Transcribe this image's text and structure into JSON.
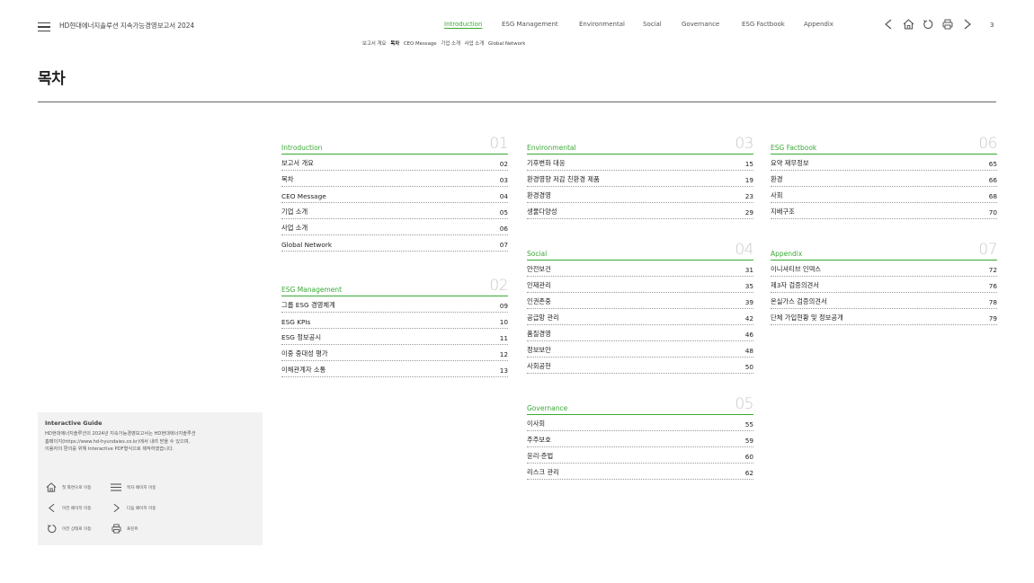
{
  "header": {
    "doc_title": "HD현대에너지솔루션 지속가능경영보고서 2024",
    "nav": [
      {
        "label": "Introduction",
        "active": true
      },
      {
        "label": "ESG Management",
        "active": false
      },
      {
        "label": "Environmental",
        "active": false
      },
      {
        "label": "Social",
        "active": false
      },
      {
        "label": "Governance",
        "active": false
      },
      {
        "label": "ESG Factbook",
        "active": false
      },
      {
        "label": "Appendix",
        "active": false
      }
    ],
    "icons": [
      "prev-icon",
      "home-icon",
      "back-icon",
      "print-icon",
      "next-icon"
    ],
    "page_number": "3",
    "subnav": [
      {
        "label": "보고서 개요",
        "active": false
      },
      {
        "label": "목차",
        "active": true
      },
      {
        "label": "CEO Message",
        "active": false
      },
      {
        "label": "기업 소개",
        "active": false
      },
      {
        "label": "사업 소개",
        "active": false
      },
      {
        "label": "Global Network",
        "active": false
      }
    ]
  },
  "page_title": "목차",
  "sections": {
    "introduction": {
      "title": "Introduction",
      "num": "01",
      "items": [
        {
          "label": "보고서 개요",
          "page": "02"
        },
        {
          "label": "목차",
          "page": "03"
        },
        {
          "label": "CEO Message",
          "page": "04"
        },
        {
          "label": "기업 소개",
          "page": "05"
        },
        {
          "label": "사업 소개",
          "page": "06"
        },
        {
          "label": "Global Network",
          "page": "07"
        }
      ]
    },
    "esg_management": {
      "title": "ESG Management",
      "num": "02",
      "items": [
        {
          "label": "그룹 ESG 경영체계",
          "page": "09"
        },
        {
          "label": "ESG KPIs",
          "page": "10"
        },
        {
          "label": "ESG 정보공시",
          "page": "11"
        },
        {
          "label": "이중 중대성 평가",
          "page": "12"
        },
        {
          "label": "이해관계자 소통",
          "page": "13"
        }
      ]
    },
    "environmental": {
      "title": "Environmental",
      "num": "03",
      "items": [
        {
          "label": "기후변화 대응",
          "page": "15"
        },
        {
          "label": "환경영향 저감 친환경 제품",
          "page": "19"
        },
        {
          "label": "환경경영",
          "page": "23"
        },
        {
          "label": "생물다양성",
          "page": "29"
        }
      ]
    },
    "social": {
      "title": "Social",
      "num": "04",
      "items": [
        {
          "label": "안전보건",
          "page": "31"
        },
        {
          "label": "인재관리",
          "page": "35"
        },
        {
          "label": "인권존중",
          "page": "39"
        },
        {
          "label": "공급망 관리",
          "page": "42"
        },
        {
          "label": "품질경영",
          "page": "46"
        },
        {
          "label": "정보보안",
          "page": "48"
        },
        {
          "label": "사회공헌",
          "page": "50"
        }
      ]
    },
    "governance": {
      "title": "Governance",
      "num": "05",
      "items": [
        {
          "label": "이사회",
          "page": "55"
        },
        {
          "label": "주주보호",
          "page": "59"
        },
        {
          "label": "윤리·준법",
          "page": "60"
        },
        {
          "label": "리스크 관리",
          "page": "62"
        }
      ]
    },
    "esg_factbook": {
      "title": "ESG Factbook",
      "num": "06",
      "items": [
        {
          "label": "요약 재무정보",
          "page": "65"
        },
        {
          "label": "환경",
          "page": "66"
        },
        {
          "label": "사회",
          "page": "68"
        },
        {
          "label": "지배구조",
          "page": "70"
        }
      ]
    },
    "appendix": {
      "title": "Appendix",
      "num": "07",
      "items": [
        {
          "label": "이니셔티브 인덱스",
          "page": "72"
        },
        {
          "label": "제3자 검증의견서",
          "page": "76"
        },
        {
          "label": "온실가스 검증의견서",
          "page": "78"
        },
        {
          "label": "단체 가입현황 및 정보공개",
          "page": "79"
        }
      ]
    }
  },
  "guide": {
    "title": "Interactive Guide",
    "text": "HD현대에너지솔루션의 2024년 지속가능경영보고서는 HD현대에너지솔루션\n홈페이지(https://www.hd-hyundaies.co.kr)에서 내려 받을 수 있으며,\n이용자의 편의를 위해 Interactive PDF형식으로 제작하였습니다.",
    "items": [
      {
        "icon": "home-icon",
        "label": "첫 화면으로 이동"
      },
      {
        "icon": "menu-icon",
        "label": "목차 페이지 이동"
      },
      {
        "icon": "prev-icon",
        "label": "이전 페이지 이동"
      },
      {
        "icon": "next-icon",
        "label": "다음 페이지 이동"
      },
      {
        "icon": "back-icon",
        "label": "이전 상태로 이동"
      },
      {
        "icon": "print-icon",
        "label": "프린트"
      }
    ]
  },
  "colors": {
    "accent": "#3aa935",
    "muted_number": "#c9c9c9",
    "guide_bg": "#f2f2f2"
  }
}
